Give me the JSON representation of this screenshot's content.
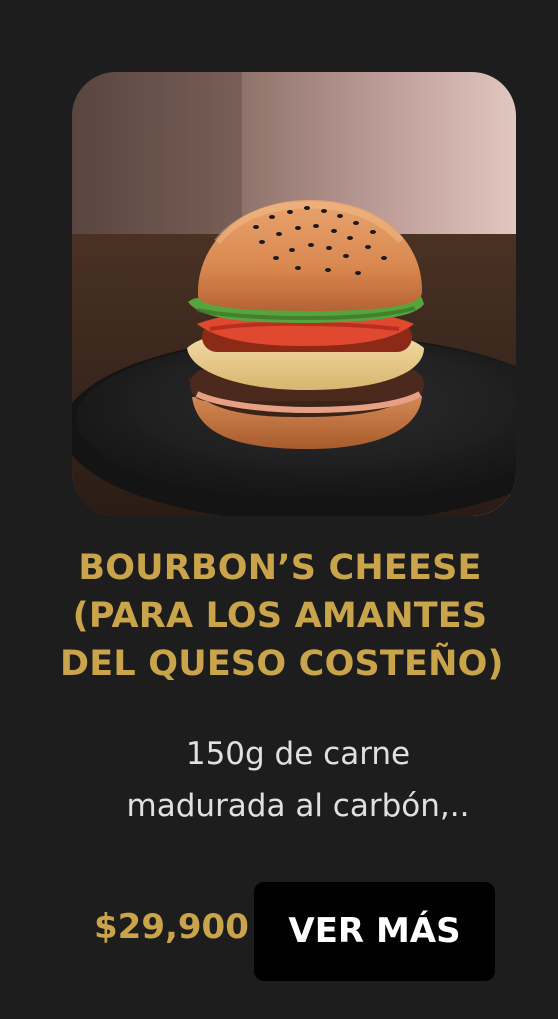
{
  "product": {
    "title_lines": [
      "BOURBON’S CHEESE",
      "(PARA LOS AMANTES",
      "DEL QUESO COSTEÑO)"
    ],
    "description_lines": [
      "150g de carne",
      "madurada al carbón,.."
    ],
    "price": "$29,900",
    "cta_label": "VER MÁS",
    "image_icon": "burger-photo-icon"
  },
  "colors": {
    "background": "#1d1d1d",
    "title": "#c9a44a",
    "price": "#c9a44a",
    "button_bg": "#000000",
    "button_text": "#ffffff",
    "description": "#e0e0e0"
  }
}
